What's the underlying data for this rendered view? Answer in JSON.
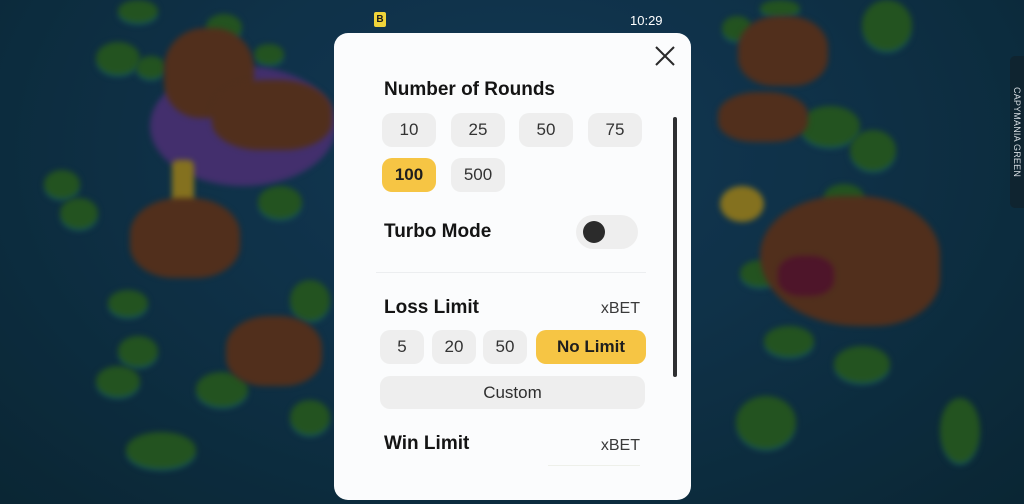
{
  "status_bar": {
    "app_badge": "B",
    "time": "10:29"
  },
  "side_tab": {
    "label": "CAPYMANIA GREEN"
  },
  "modal": {
    "close_icon": "close-icon",
    "number_of_rounds": {
      "title": "Number of Rounds",
      "options": [
        "10",
        "25",
        "50",
        "75",
        "100",
        "500"
      ],
      "selected": "100"
    },
    "turbo_mode": {
      "title": "Turbo Mode",
      "enabled": false
    },
    "loss_limit": {
      "title": "Loss Limit",
      "unit": "xBET",
      "options": [
        "5",
        "20",
        "50",
        "No Limit"
      ],
      "selected": "No Limit",
      "custom_label": "Custom"
    },
    "win_limit": {
      "title": "Win Limit",
      "unit": "xBET"
    }
  },
  "colors": {
    "accent": "#f6c544",
    "chip_bg": "#eeeeee",
    "modal_bg": "#fbfcfd",
    "background": "#123a52"
  }
}
